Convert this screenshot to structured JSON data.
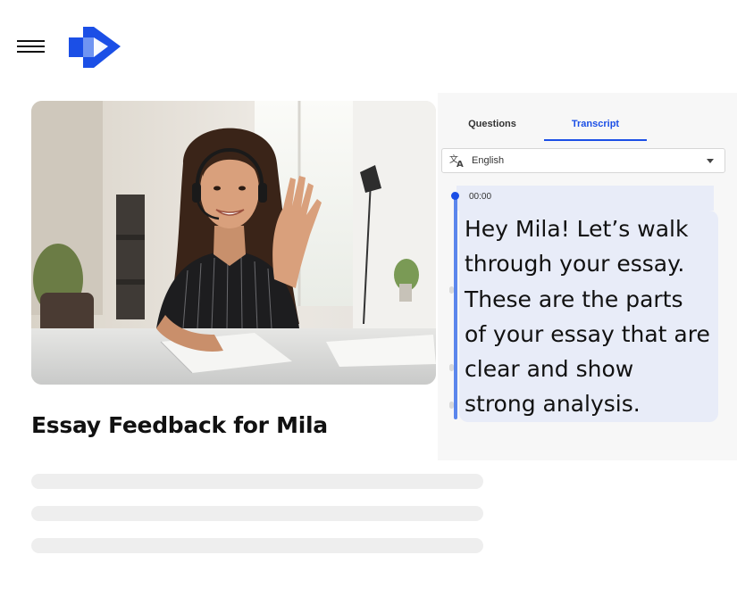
{
  "header": {
    "menu_icon": "hamburger-menu-icon",
    "logo_icon": "play-logo-icon",
    "brand_color": "#1b4fe6"
  },
  "video": {
    "title": "Essay Feedback for Mila"
  },
  "transcript_panel": {
    "tabs": [
      {
        "label": "Questions",
        "active": false
      },
      {
        "label": "Transcript",
        "active": true
      }
    ],
    "language": {
      "icon": "translate-icon",
      "selected": "English",
      "dropdown_icon": "caret-down-icon"
    },
    "entries": [
      {
        "timestamp": "00:00",
        "lines": [
          "Hey Mila! Let’s walk",
          "through your essay.",
          "These are the parts",
          "of your essay that are",
          "clear and show",
          "strong analysis."
        ]
      }
    ],
    "accent_color": "#1b4fe6",
    "bubble_color": "#e8ecf8"
  }
}
